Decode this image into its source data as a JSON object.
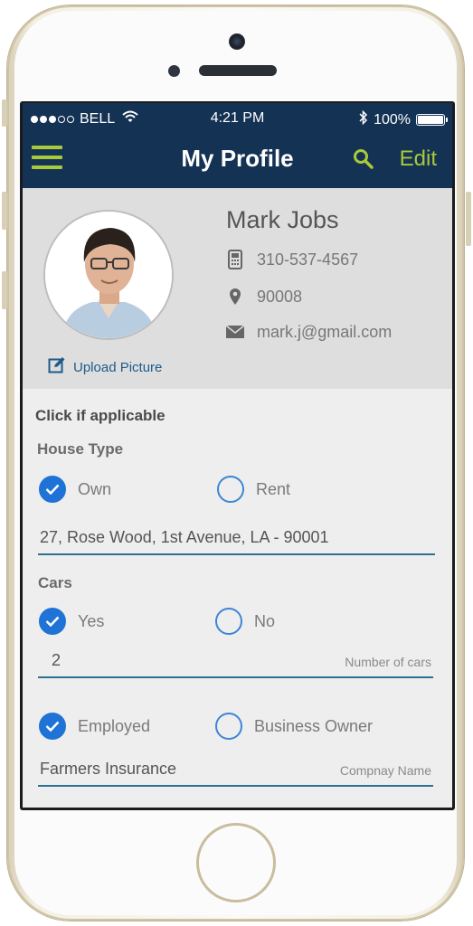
{
  "status_bar": {
    "carrier": "BELL",
    "time": "4:21 PM",
    "battery": "100%",
    "battery_level": 1.0
  },
  "nav": {
    "title": "My Profile",
    "edit_label": "Edit"
  },
  "profile": {
    "name": "Mark Jobs",
    "phone": "310-537-4567",
    "zip": "90008",
    "email": "mark.j@gmail.com",
    "upload_label": "Upload Picture"
  },
  "form": {
    "intro": "Click if applicable",
    "house_type": {
      "label": "House Type",
      "options": [
        {
          "label": "Own",
          "checked": true
        },
        {
          "label": "Rent",
          "checked": false
        }
      ],
      "address": "27, Rose Wood, 1st Avenue, LA - 90001"
    },
    "cars": {
      "label": "Cars",
      "options": [
        {
          "label": "Yes",
          "checked": true
        },
        {
          "label": "No",
          "checked": false
        }
      ],
      "count": "2",
      "count_hint": "Number of cars"
    },
    "employment": {
      "options": [
        {
          "label": "Employed",
          "checked": true
        },
        {
          "label": "Business Owner",
          "checked": false
        }
      ],
      "company": "Farmers Insurance",
      "company_hint": "Compnay Name"
    }
  },
  "colors": {
    "nav_bg": "#143254",
    "accent_green": "#a8c93a",
    "radio_blue": "#1f73d6",
    "field_underline": "#2e6f92"
  }
}
